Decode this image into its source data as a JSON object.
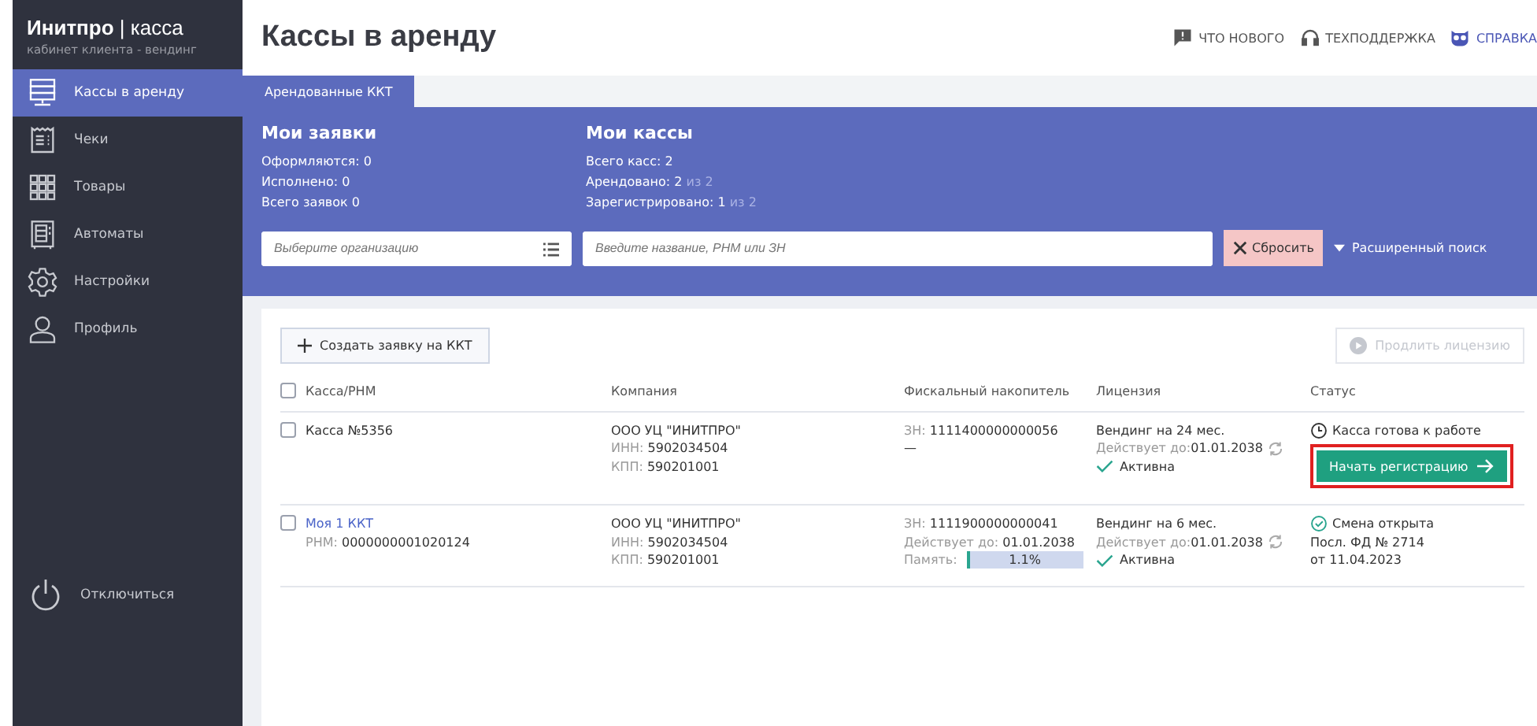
{
  "brand": {
    "name": "Инитпро",
    "separator": "|",
    "product": "касса",
    "subtitle": "кабинет клиента - вендинг"
  },
  "sidebar": {
    "items": [
      {
        "label": "Кассы в аренду",
        "kind": "server",
        "selected": true
      },
      {
        "label": "Чеки",
        "kind": "receipt",
        "selected": false
      },
      {
        "label": "Товары",
        "kind": "grid",
        "selected": false
      },
      {
        "label": "Автоматы",
        "kind": "machine",
        "selected": false
      },
      {
        "label": "Настройки",
        "kind": "gear",
        "selected": false
      },
      {
        "label": "Профиль",
        "kind": "person",
        "selected": false
      }
    ],
    "logout": "Отключиться"
  },
  "header": {
    "title": "Кассы в аренду",
    "links": [
      {
        "label": "ЧТО НОВОГО",
        "kind": "chat"
      },
      {
        "label": "ТЕХПОДДЕРЖКА",
        "kind": "headset"
      },
      {
        "label": "СПРАВКА",
        "kind": "owl"
      }
    ]
  },
  "tabs": [
    {
      "label": "Арендованные ККТ",
      "selected": true
    }
  ],
  "summary": [
    {
      "title": "Мои заявки",
      "lines": [
        {
          "text": "Оформляются: 0"
        },
        {
          "text": "Исполнено: 0"
        },
        {
          "text": "Всего заявок 0"
        }
      ]
    },
    {
      "title": "Мои кассы",
      "lines": [
        {
          "text": "Всего касс: 2"
        },
        {
          "text": "Арендовано: 2",
          "suffix": "из 2"
        },
        {
          "text": "Зарегистрировано: 1",
          "suffix": "из 2"
        }
      ]
    }
  ],
  "filters": {
    "organization_placeholder": "Выберите организацию",
    "search_placeholder": "Введите название, РНМ или ЗН",
    "reset": "Сбросить",
    "advanced": "Расширенный поиск"
  },
  "actions": {
    "create": "Создать заявку на ККТ",
    "extend": "Продлить лицензию",
    "extend_disabled": true
  },
  "table": {
    "all_checked": false,
    "columns": [
      "Касса/РНМ",
      "Компания",
      "Фискальный накопитель",
      "Лицензия",
      "Статус"
    ],
    "rows": [
      {
        "checked": false,
        "name": "Касса №5356",
        "name_link": false,
        "company": "ООО УЦ \"ИНИТПРО\"",
        "inn_label": "ИНН:",
        "inn": "5902034504",
        "kpp_label": "КПП:",
        "kpp": "590201001",
        "fn_label": "ЗН:",
        "fn": "1111400000000056",
        "fn_dash": "—",
        "license": "Вендинг на 24 мес.",
        "valid_label": "Действует до:",
        "valid": "01.01.2038",
        "license_status": "Активна",
        "kind": "clock",
        "status": "Касса готова к работе",
        "button": "Начать регистрацию",
        "button_highlighted": true
      },
      {
        "checked": false,
        "name": "Моя 1 ККТ",
        "name_link": true,
        "rnm_label": "РНМ:",
        "rnm": "0000000001020124",
        "company": "ООО УЦ \"ИНИТПРО\"",
        "inn_label": "ИНН:",
        "inn": "5902034504",
        "kpp_label": "КПП:",
        "kpp": "590201001",
        "fn_label": "ЗН:",
        "fn": "1111900000000041",
        "fn_valid_label": "Действует до:",
        "fn_valid": "01.01.2038",
        "memory_label": "Память:",
        "memory": "1.1%",
        "level": 0.011,
        "license": "Вендинг на 6 мес.",
        "valid_label": "Действует до:",
        "valid": "01.01.2038",
        "license_status": "Активна",
        "kind": "check",
        "status": "Смена открыта",
        "status_lines": [
          "Посл. ФД № 2714",
          "от 11.04.2023"
        ]
      }
    ]
  }
}
